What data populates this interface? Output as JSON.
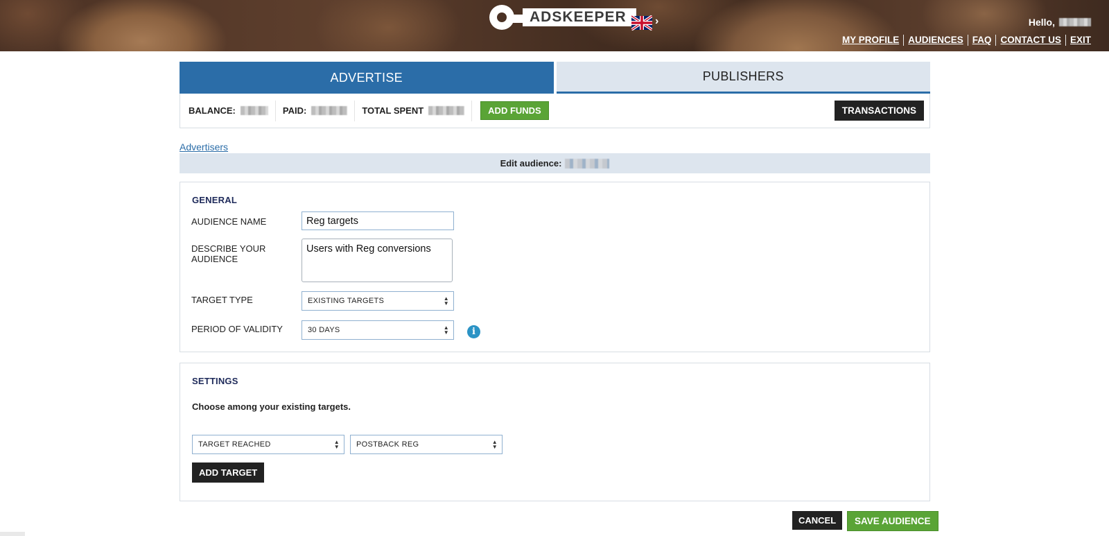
{
  "header": {
    "logo_text": "ADSKEEPER",
    "language_icon": "uk-flag-icon",
    "greeting": "Hello,",
    "links": [
      "MY PROFILE",
      "AUDIENCES",
      "FAQ",
      "CONTACT US",
      "EXIT"
    ]
  },
  "tabs": [
    {
      "label": "ADVERTISE",
      "active": true
    },
    {
      "label": "PUBLISHERS",
      "active": false
    }
  ],
  "balance": {
    "balance_label": "BALANCE:",
    "paid_label": "PAID:",
    "total_spent_label": "TOTAL SPENT",
    "add_funds_label": "ADD FUNDS",
    "transactions_label": "TRANSACTIONS"
  },
  "breadcrumb": {
    "advertisers_link": "Advertisers"
  },
  "edit_title": "Edit audience:",
  "general": {
    "heading": "GENERAL",
    "audience_name_label": "AUDIENCE NAME",
    "audience_name_value": "Reg targets",
    "describe_label_line1": "DESCRIBE YOUR",
    "describe_label_line2": "AUDIENCE",
    "describe_value": "Users with Reg conversions",
    "target_type_label": "TARGET TYPE",
    "target_type_value": "EXISTING TARGETS",
    "validity_label": "PERIOD OF VALIDITY",
    "validity_value": "30 DAYS",
    "info_icon": "info-icon"
  },
  "settings": {
    "heading": "SETTINGS",
    "instruction": "Choose among your existing targets.",
    "condition_value": "TARGET REACHED",
    "target_value": "POSTBACK REG",
    "add_target_label": "ADD TARGET"
  },
  "actions": {
    "cancel_label": "CANCEL",
    "save_label": "SAVE AUDIENCE"
  },
  "colors": {
    "primary_blue": "#2b6da8",
    "green": "#5aa436",
    "dark": "#222222",
    "tab_inactive": "#dde5ee"
  }
}
